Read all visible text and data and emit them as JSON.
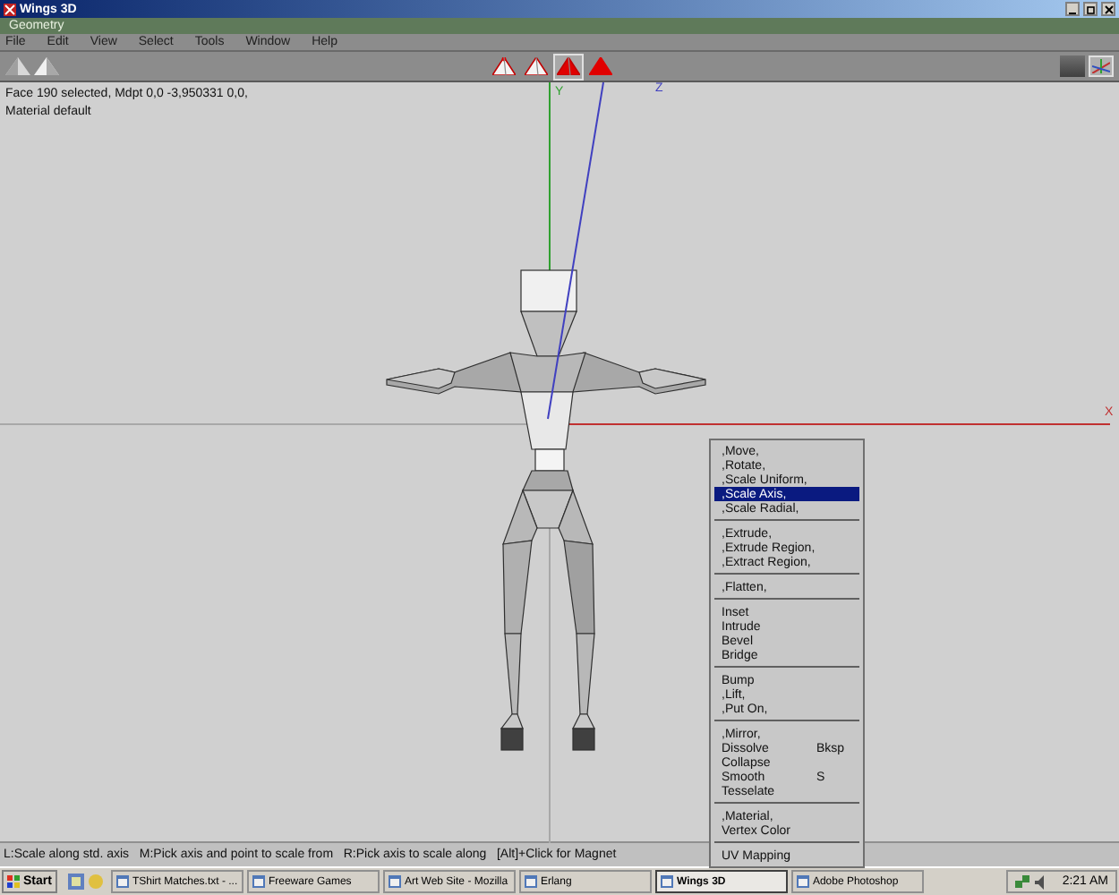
{
  "window": {
    "title": "Wings 3D"
  },
  "geometry_bar": {
    "title": "Geometry"
  },
  "menu_bar": [
    "File",
    "Edit",
    "View",
    "Select",
    "Tools",
    "Window",
    "Help"
  ],
  "selection_modes": [
    {
      "kind": "vertex",
      "selected": false
    },
    {
      "kind": "edge",
      "selected": false
    },
    {
      "kind": "face",
      "selected": true
    },
    {
      "kind": "body",
      "selected": false
    }
  ],
  "info": [
    "Face 190 selected, Mdpt 0,0 -3,950331 0,0,",
    "Material default"
  ],
  "axes": {
    "y": "Y",
    "z": "Z",
    "x": "X"
  },
  "context_menu": [
    [
      {
        "label": ",Move,",
        "selected": false
      },
      {
        "label": ",Rotate,",
        "selected": false
      },
      {
        "label": ",Scale Uniform,",
        "selected": false
      },
      {
        "label": ",Scale Axis,",
        "selected": true
      },
      {
        "label": ",Scale Radial,",
        "selected": false
      }
    ],
    [
      {
        "label": ",Extrude,",
        "selected": false
      },
      {
        "label": ",Extrude Region,",
        "selected": false
      },
      {
        "label": ",Extract Region,",
        "selected": false
      }
    ],
    [
      {
        "label": ",Flatten,",
        "selected": false
      }
    ],
    [
      {
        "label": "Inset",
        "selected": false
      },
      {
        "label": "Intrude",
        "selected": false
      },
      {
        "label": "Bevel",
        "selected": false
      },
      {
        "label": "Bridge",
        "selected": false
      }
    ],
    [
      {
        "label": "Bump",
        "selected": false
      },
      {
        "label": ",Lift,",
        "selected": false
      },
      {
        "label": ",Put On,",
        "selected": false
      }
    ],
    [
      {
        "label": ",Mirror,",
        "selected": false
      },
      {
        "label": "Dissolve",
        "shortcut": "Bksp",
        "selected": false
      },
      {
        "label": "Collapse",
        "selected": false
      },
      {
        "label": "Smooth",
        "shortcut": "S",
        "selected": false
      },
      {
        "label": "Tesselate",
        "selected": false
      }
    ],
    [
      {
        "label": ",Material,",
        "selected": false
      },
      {
        "label": "Vertex Color",
        "selected": false
      }
    ],
    [
      {
        "label": "UV Mapping",
        "selected": false
      }
    ]
  ],
  "status_bar": "L:Scale along std. axis   M:Pick axis and point to scale from   R:Pick axis to scale along   [Alt]+Click for Magnet",
  "taskbar": {
    "start": "Start",
    "tasks": [
      {
        "label": "TShirt Matches.txt - ...",
        "selected": false
      },
      {
        "label": "Freeware Games",
        "selected": false
      },
      {
        "label": "Art Web Site - Mozilla",
        "selected": false
      },
      {
        "label": "Erlang",
        "selected": false
      },
      {
        "label": "Wings 3D",
        "selected": true
      },
      {
        "label": "Adobe Photoshop",
        "selected": false
      }
    ],
    "clock": "2:21 AM"
  }
}
